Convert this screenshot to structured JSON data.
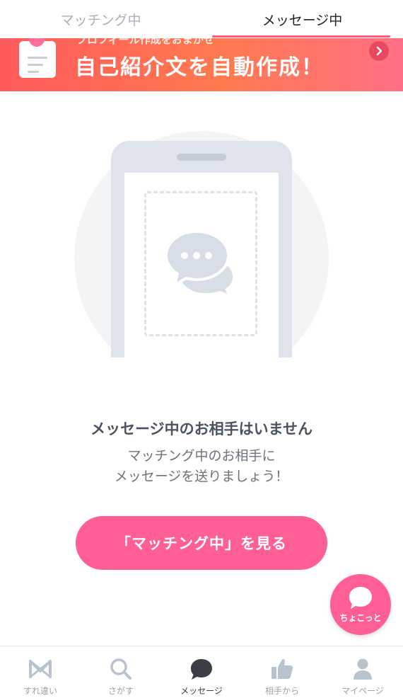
{
  "tabs": [
    {
      "label": "マッチング中",
      "active": false
    },
    {
      "label": "メッセージ中",
      "active": true
    }
  ],
  "banner": {
    "subtext": "プロフィール作成をおまかせ",
    "title": "自己紹介文を自動作成！",
    "arrow_icon": "chevron-right-icon"
  },
  "empty_state": {
    "title": "メッセージ中のお相手はいません",
    "description_line1": "マッチング中のお相手に",
    "description_line2": "メッセージを送りましょう！"
  },
  "cta_button": {
    "label": "「マッチング中」を見る"
  },
  "floating_button": {
    "label": "ちょこっと",
    "icon": "chat-bubble-icon"
  },
  "bottom_nav": [
    {
      "label": "すれ違い",
      "icon": "crossing-icon",
      "active": false
    },
    {
      "label": "さがす",
      "icon": "search-icon",
      "active": false
    },
    {
      "label": "メッセージ",
      "icon": "message-icon",
      "active": true
    },
    {
      "label": "相手から",
      "icon": "thumbs-up-icon",
      "active": false
    },
    {
      "label": "マイページ",
      "icon": "person-icon",
      "active": false
    }
  ],
  "colors": {
    "accent_pink": "#ff5f93",
    "banner_start": "#ff5a5c",
    "banner_end": "#ff6f86",
    "illustration_gray": "#dfe4ec",
    "nav_inactive": "#9aa3ad"
  }
}
